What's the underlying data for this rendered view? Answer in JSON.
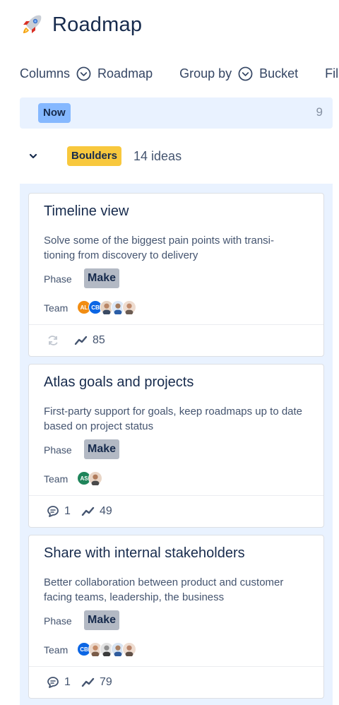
{
  "header": {
    "title": "Roadmap",
    "icon": "rocket-icon"
  },
  "toolbar": {
    "columns_label": "Columns",
    "columns_value": "Roadmap",
    "group_label": "Group by",
    "group_value": "Bucket",
    "filter_label": "Fil"
  },
  "column": {
    "label": "Now",
    "count": "9",
    "color": "#85B8FF"
  },
  "group": {
    "label": "Boulders",
    "count_text": "14 ideas",
    "color": "#F8C83D"
  },
  "cards": [
    {
      "title": "Timeline view",
      "description": "Solve some of the biggest pain points with transi- tioning from discovery to delivery",
      "phase_label": "Phase",
      "phase": "Make",
      "team_label": "Team",
      "team_initials": [
        "AL",
        "CB"
      ],
      "comments": "",
      "votes": "85"
    },
    {
      "title": "Atlas goals and projects",
      "description": "First-party support for goals, keep roadmaps up to date based on project status",
      "phase_label": "Phase",
      "phase": "Make",
      "team_label": "Team",
      "team_initials": [
        "AS"
      ],
      "comments": "1",
      "votes": "49"
    },
    {
      "title": "Share with internal stakeholders",
      "description": "Better collaboration between product and customer facing teams, leadership, the business",
      "phase_label": "Phase",
      "phase": "Make",
      "team_label": "Team",
      "team_initials": [
        "CB"
      ],
      "comments": "1",
      "votes": "79"
    }
  ]
}
